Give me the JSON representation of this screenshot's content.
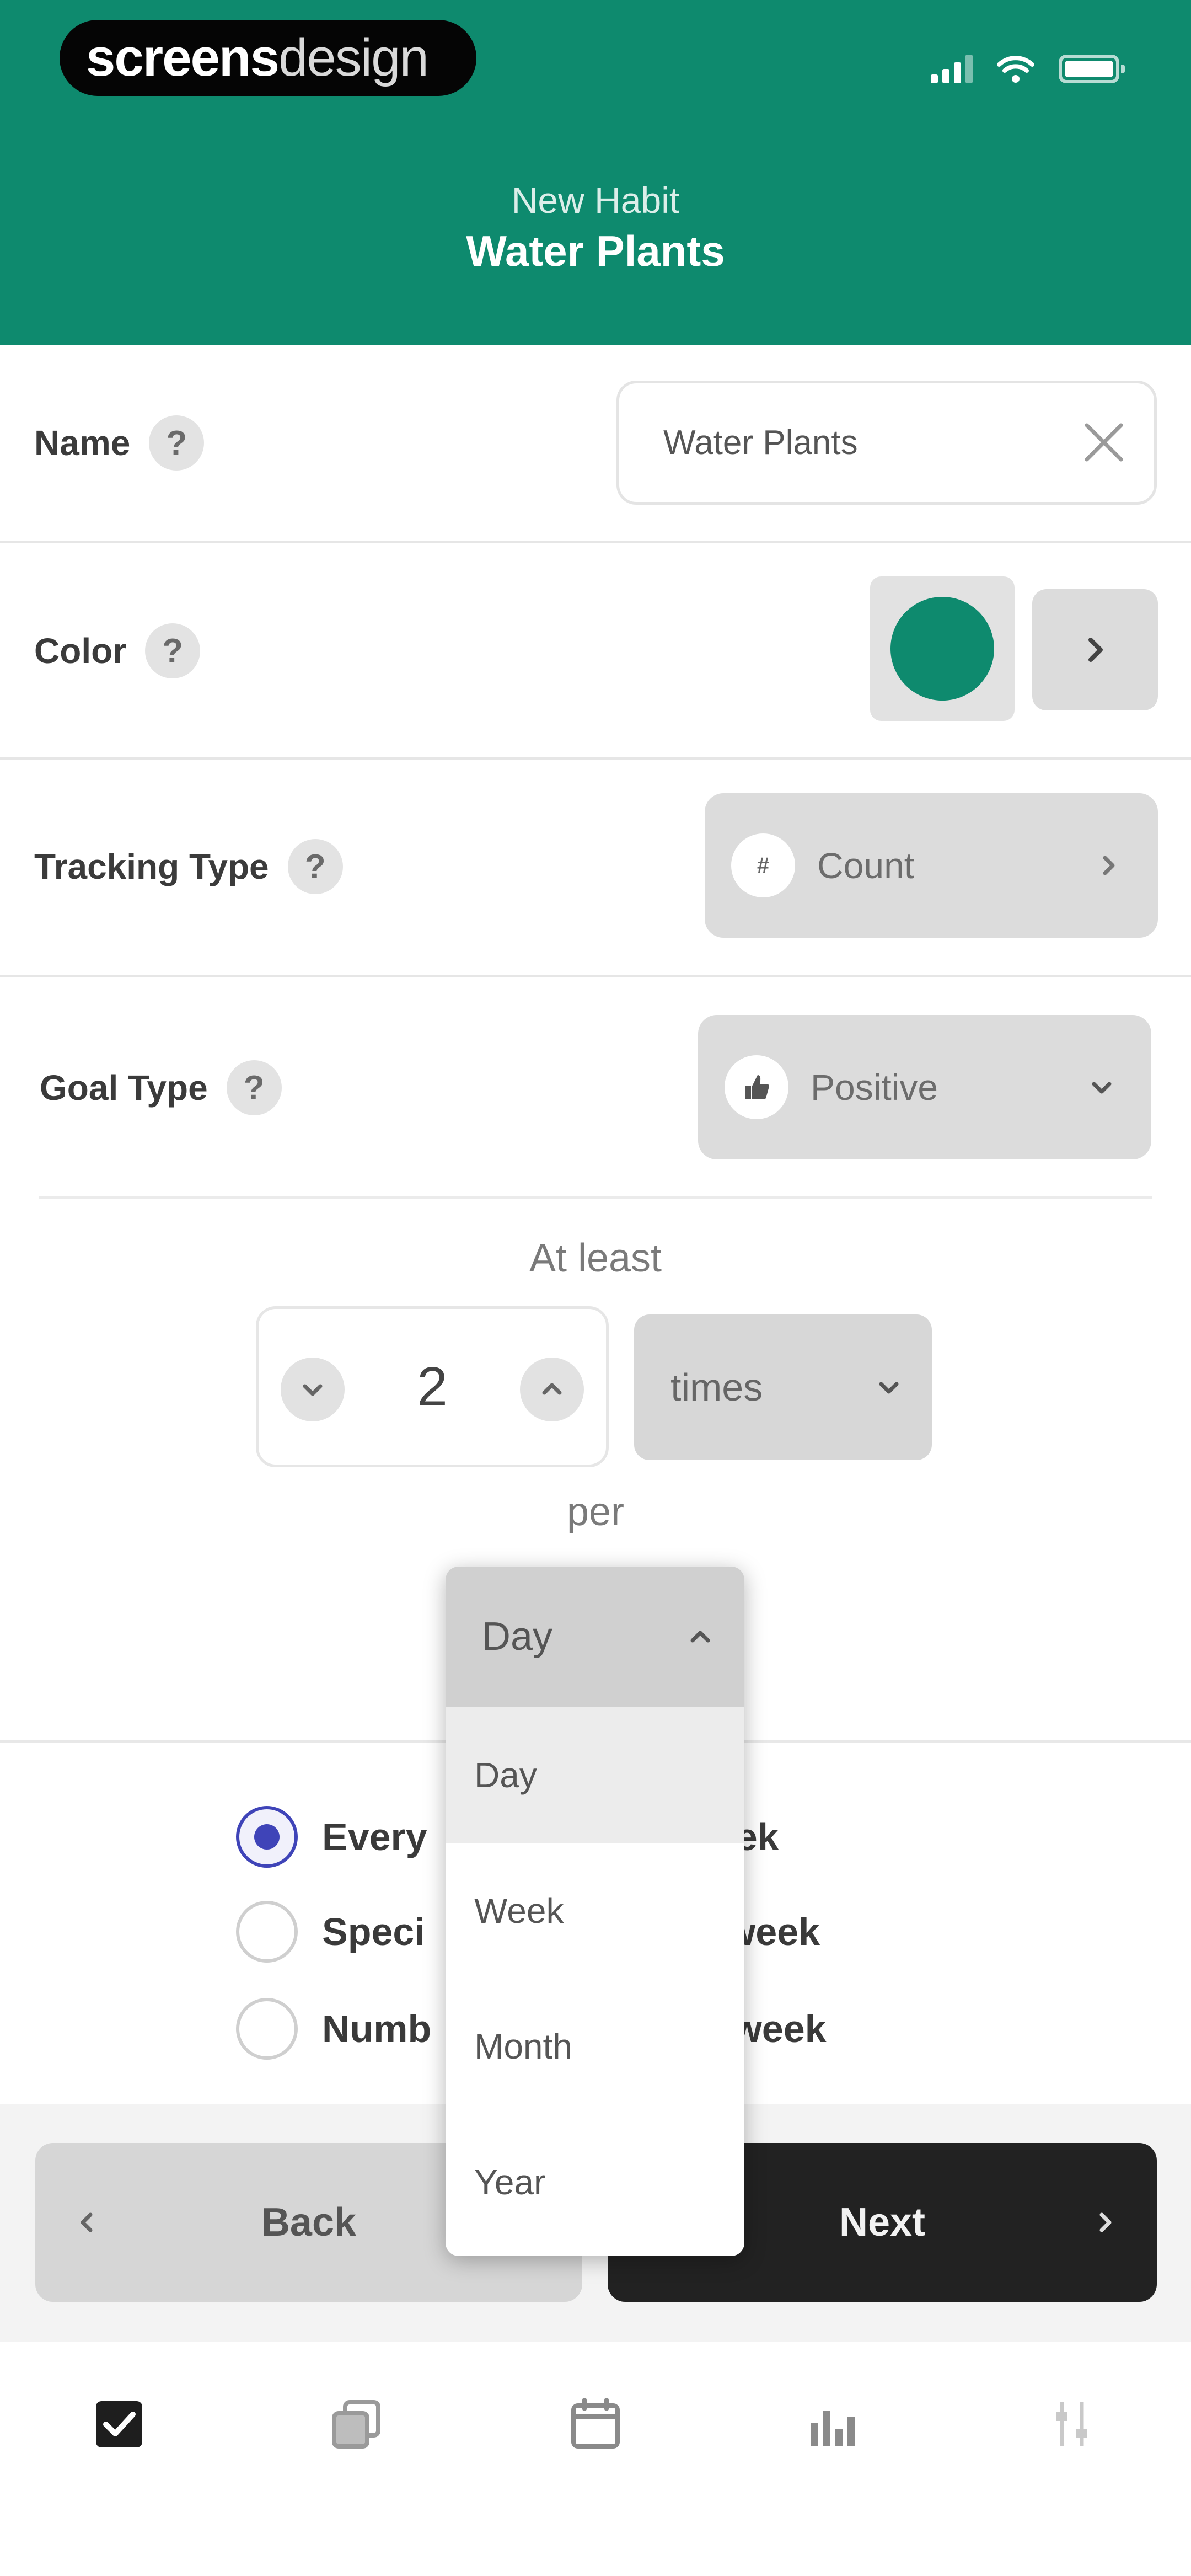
{
  "status_bar": {
    "watermark_bold": "screens",
    "watermark_light": "design"
  },
  "header": {
    "subtitle": "New Habit",
    "title": "Water Plants",
    "color": "#0e8a6e"
  },
  "form": {
    "name": {
      "label": "Name",
      "help": "?",
      "value": "Water Plants"
    },
    "color": {
      "label": "Color",
      "help": "?",
      "swatch": "#0e8a6e"
    },
    "tracking_type": {
      "label": "Tracking Type",
      "help": "?",
      "badge": "#",
      "value": "Count"
    },
    "goal_type": {
      "label": "Goal Type",
      "help": "?",
      "value": "Positive"
    },
    "goal": {
      "at_least": "At least",
      "count": "2",
      "unit": "times",
      "per": "per",
      "period": "Day"
    },
    "schedule": {
      "options": [
        {
          "label": "Every",
          "label_tail": "ek",
          "selected": true
        },
        {
          "label": "Speci",
          "label_tail": "week",
          "selected": false
        },
        {
          "label": "Numb",
          "label_tail": "week",
          "selected": false
        }
      ]
    }
  },
  "dropdown": {
    "selected": "Day",
    "options": [
      "Day",
      "Week",
      "Month",
      "Year"
    ]
  },
  "footer": {
    "back_label": "Back",
    "next_label": "Next"
  },
  "tabbar": {
    "items": [
      "checkbox-icon",
      "copy-icon",
      "calendar-icon",
      "bar-chart-icon",
      "settings-icon"
    ]
  }
}
